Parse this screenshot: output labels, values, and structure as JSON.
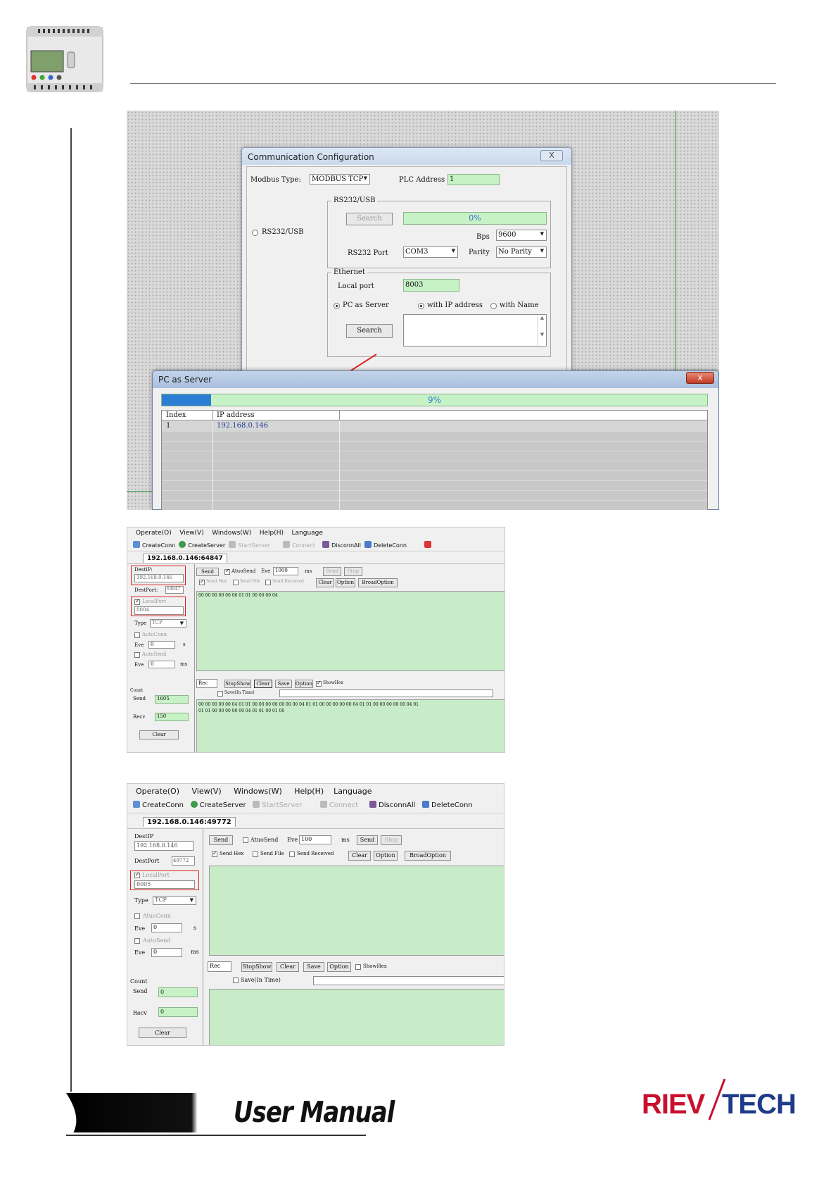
{
  "header": {
    "device_icon": "plc-device-image"
  },
  "shot1": {
    "dialog": {
      "title": "Communication Configuration",
      "close": "X",
      "modbus_type_label": "Modbus Type:",
      "modbus_type_value": "MODBUS TCP",
      "plc_address_label": "PLC Address",
      "plc_address_value": "1",
      "rs232_group": "RS232/USB",
      "search": "Search",
      "progress": "0%",
      "rs232_radio": "RS232/USB",
      "bps_label": "Bps",
      "bps_value": "9600",
      "port_label": "RS232 Port",
      "port_value": "COM3",
      "parity_label": "Parity",
      "parity_value": "No Parity",
      "ethernet_group": "Ethernet",
      "local_port_label": "Local port",
      "local_port_value": "8003",
      "pc_server": "PC as Server",
      "with_ip": "with IP address",
      "with_name": "with Name",
      "search2": "Search"
    },
    "server": {
      "title": "PC as Server",
      "close": "x",
      "progress_value": 0.09,
      "progress_label": "9%",
      "col_index": "Index",
      "col_ip": "IP address",
      "rows": [
        {
          "index": "1",
          "ip": "192.168.0.146"
        }
      ]
    }
  },
  "shot2": {
    "menu": [
      "Operate(O)",
      "View(V)",
      "Windows(W)",
      "Help(H)",
      "Language"
    ],
    "toolbar": [
      "CreateConn",
      "CreateServer",
      "StartServer",
      "Connect",
      "DisconnAll",
      "DeleteConn"
    ],
    "tab": "192.168.0.146:64847",
    "dest_ip_label": "DestIP:",
    "dest_ip": "192.168.0.146",
    "dest_port_label": "DestPort:",
    "dest_port": "64847",
    "local_port_label": "LocalPort",
    "local_port": "8004",
    "type_label": "Type",
    "type_value": "TCP",
    "auto_conn": "AutoConn",
    "eve_label": "Eve",
    "eve1": "0",
    "eve1_unit": "s",
    "auto_send": "AutoSend",
    "eve2": "0",
    "eve2_unit": "ms",
    "count_label": "Count",
    "send_label": "Send",
    "send_count": "1605",
    "recv_label": "Recv",
    "recv_count": "150",
    "clear": "Clear",
    "send_btn": "Send",
    "auto_send_top": "AtuoSend",
    "eve_top": "Eve",
    "eve_top_value": "1000",
    "eve_top_unit": "ms",
    "send2": "Send",
    "stop": "Stop",
    "send_hex": "Send Hex",
    "send_file": "Send File",
    "send_received": "Send Received",
    "clear2": "Clear",
    "option": "Option",
    "broad_option": "BroadOption",
    "send_data": "00 00 00 00 00 06 01 01 00 00 00 04",
    "rec": "Rec",
    "stop_show": "StopShow",
    "clear3": "Clear",
    "save": "Save",
    "option2": "Option",
    "show_hex": "ShowHex",
    "save_in_time": "Save(In Time)",
    "recv_data_1": "00 00 00 00 00 04 01 01 00 00 00 00 00 00 00 04 01 01 00 00 00 00 00 04 01 01 00 00 00 00 00 04 01",
    "recv_data_2": "01 01 00 00 00 00 00 04 01 01 00 01 00"
  },
  "shot3": {
    "menu": [
      "Operate(O)",
      "View(V)",
      "Windows(W)",
      "Help(H)",
      "Language"
    ],
    "toolbar": [
      "CreateConn",
      "CreateServer",
      "StartServer",
      "Connect",
      "DisconnAll",
      "DeleteConn"
    ],
    "tab": "192.168.0.146:49772",
    "dest_ip_label": "DestIP",
    "dest_ip": "192.168.0.146",
    "dest_port_label": "DestPort",
    "dest_port": "49772",
    "local_port_label": "LocalPort",
    "local_port": "8005",
    "type_label": "Type",
    "type_value": "TCP",
    "auto_conn": "AtuoConn",
    "eve_label": "Eve",
    "eve1": "0",
    "eve1_unit": "s",
    "auto_send": "AutoSend",
    "eve2": "0",
    "eve2_unit": "ms",
    "count_label": "Count",
    "send_label": "Send",
    "send_count": "0",
    "recv_label": "Recv",
    "recv_count": "0",
    "clear": "Clear",
    "send_btn": "Send",
    "auto_send_top": "AtuoSend",
    "eve_top": "Eve",
    "eve_top_value": "100",
    "eve_top_unit": "ms",
    "send2": "Send",
    "stop": "Stop",
    "send_hex": "Send Hex",
    "send_file": "Send File",
    "send_received": "Send Received",
    "clear2": "Clear",
    "option": "Option",
    "broad_option": "BroadOption",
    "rec": "Rec",
    "stop_show": "StopShow",
    "clear3": "Clear",
    "save": "Save",
    "option2": "Option",
    "show_hex": "ShowHex",
    "save_in_time": "Save(In Time)"
  },
  "footer": {
    "manual": "User Manual",
    "logo_left": "RIEV",
    "logo_right": "TECH",
    "colors": {
      "logo": "#c8102e",
      "logo_dark": "#1e3a8a"
    }
  }
}
